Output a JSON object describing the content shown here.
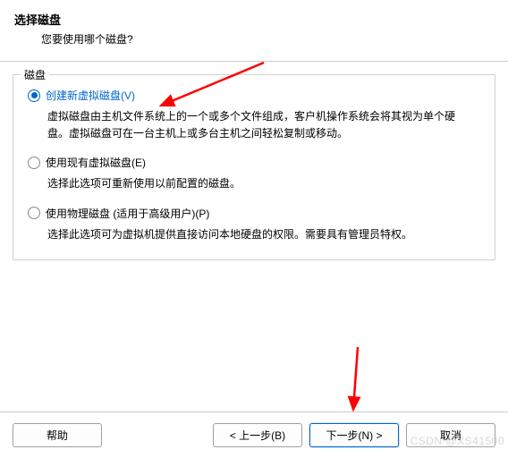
{
  "header": {
    "title": "选择磁盘",
    "subtitle": "您要使用哪个磁盘?"
  },
  "group": {
    "legend": "磁盘",
    "options": [
      {
        "label": "创建新虚拟磁盘(V)",
        "desc": "虚拟磁盘由主机文件系统上的一个或多个文件组成，客户机操作系统会将其视为单个硬盘。虚拟磁盘可在一台主机上或多台主机之间轻松复制或移动。",
        "selected": true
      },
      {
        "label": "使用现有虚拟磁盘(E)",
        "desc": "选择此选项可重新使用以前配置的磁盘。",
        "selected": false
      },
      {
        "label": "使用物理磁盘 (适用于高级用户)(P)",
        "desc": "选择此选项可为虚拟机提供直接访问本地硬盘的权限。需要具有管理员特权。",
        "selected": false
      }
    ]
  },
  "buttons": {
    "help": "帮助",
    "back": "< 上一步(B)",
    "next": "下一步(N) >",
    "cancel": "取消"
  },
  "annotation": {
    "arrow_color": "#ff0000"
  },
  "watermark": "CSDN @XS41500"
}
